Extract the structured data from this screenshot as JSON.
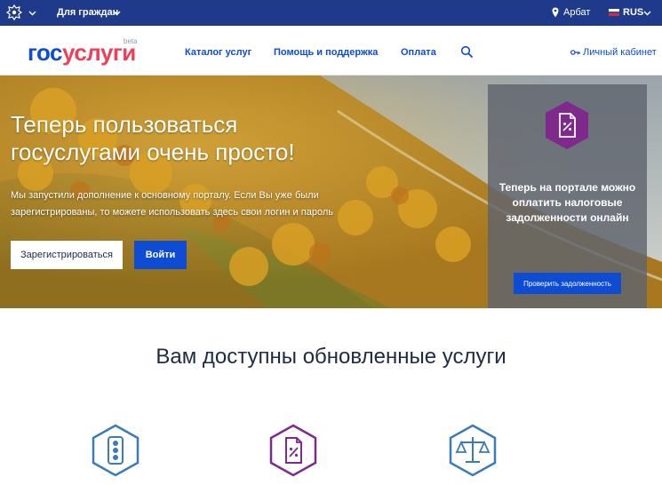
{
  "topbar": {
    "audience_label": "Для граждан",
    "location": "Арбат",
    "language": "RUS"
  },
  "header": {
    "logo_part1": "гос",
    "logo_part2": "услуги",
    "logo_badge": "beta",
    "nav": [
      {
        "label": "Каталог услуг"
      },
      {
        "label": "Помощь и поддержка"
      },
      {
        "label": "Оплата"
      }
    ],
    "cabinet_label": "Личный кабинет"
  },
  "hero": {
    "title": "Теперь пользоваться госуслугами очень просто!",
    "subtitle": "Мы запустили дополнение к основному порталу. Если Вы уже были зарегистрированы, то можете использовать здесь свои логин и пароль",
    "register_label": "Зарегистрироваться",
    "login_label": "Войти"
  },
  "promo": {
    "text": "Теперь на портале можно оплатить налоговые задолженности онлайн",
    "button_label": "Проверить задолженность"
  },
  "services": {
    "title": "Вам доступны обновленные услуги"
  },
  "colors": {
    "topbar": "#1f3a8a",
    "brand_blue": "#0d4cd3",
    "brand_red": "#ee3f58",
    "tax_purple": "#7d2a8c",
    "service_blue": "#3a7bb8"
  },
  "icons": {
    "emblem": "coat-of-arms-icon",
    "location": "map-pin-icon",
    "search": "search-icon",
    "cabinet": "key-icon",
    "promo": "tax-document-icon",
    "service_1": "traffic-light-icon",
    "service_2": "tax-document-icon",
    "service_3": "scales-icon"
  }
}
